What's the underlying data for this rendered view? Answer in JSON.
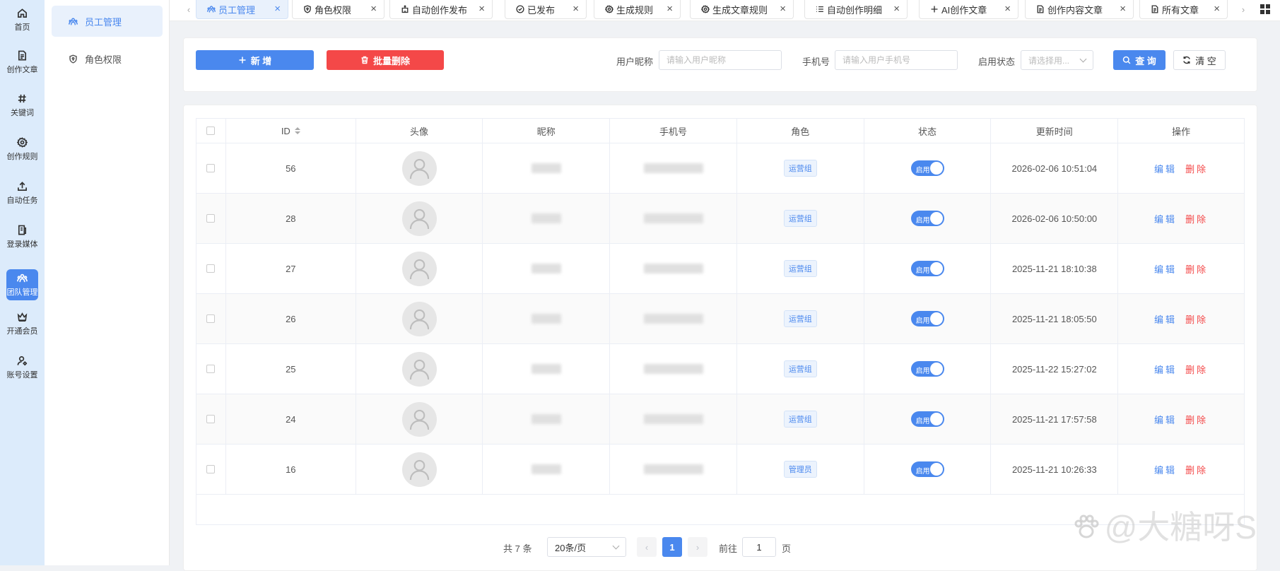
{
  "rail": [
    {
      "label": "首页",
      "icon": "home-icon"
    },
    {
      "label": "创作文章",
      "icon": "document-icon"
    },
    {
      "label": "关键词",
      "icon": "hash-icon"
    },
    {
      "label": "创作规则",
      "icon": "gear-icon"
    },
    {
      "label": "自动任务",
      "icon": "upload-icon"
    },
    {
      "label": "登录媒体",
      "icon": "media-icon"
    },
    {
      "label": "团队管理",
      "icon": "team-icon",
      "active": true
    },
    {
      "label": "开通会员",
      "icon": "crown-icon"
    },
    {
      "label": "账号设置",
      "icon": "user-settings-icon"
    }
  ],
  "submenu": [
    {
      "label": "员工管理",
      "icon": "team-icon",
      "active": true
    },
    {
      "label": "角色权限",
      "icon": "shield-icon"
    }
  ],
  "tabs": [
    {
      "label": "员工管理",
      "icon": "team-icon",
      "active": true
    },
    {
      "label": "角色权限",
      "icon": "shield-icon"
    },
    {
      "label": "自动创作发布",
      "icon": "robot-icon"
    },
    {
      "label": "已发布",
      "icon": "check-circle-icon"
    },
    {
      "label": "生成规则",
      "icon": "gear-icon"
    },
    {
      "label": "生成文章规则",
      "icon": "gear-icon"
    },
    {
      "label": "自动创作明细",
      "icon": "list-icon"
    },
    {
      "label": "AI创作文章",
      "icon": "plus-icon"
    },
    {
      "label": "创作内容文章",
      "icon": "document-icon"
    },
    {
      "label": "所有文章",
      "icon": "document-icon"
    }
  ],
  "toolbar": {
    "add_label": "新 增",
    "batch_delete_label": "批量删除",
    "nickname_label": "用户昵称",
    "nickname_placeholder": "请输入用户昵称",
    "phone_label": "手机号",
    "phone_placeholder": "请输入用户手机号",
    "status_label": "启用状态",
    "status_placeholder": "请选择用...",
    "query_label": "查 询",
    "clear_label": "清 空"
  },
  "table": {
    "columns": [
      "ID",
      "头像",
      "昵称",
      "手机号",
      "角色",
      "状态",
      "更新时间",
      "操作"
    ],
    "rows": [
      {
        "id": "56",
        "role": "运营组",
        "status": "启用",
        "updated": "2026-02-06 10:51:04"
      },
      {
        "id": "28",
        "role": "运营组",
        "status": "启用",
        "updated": "2026-02-06 10:50:00"
      },
      {
        "id": "27",
        "role": "运营组",
        "status": "启用",
        "updated": "2025-11-21 18:10:38"
      },
      {
        "id": "26",
        "role": "运营组",
        "status": "启用",
        "updated": "2025-11-21 18:05:50"
      },
      {
        "id": "25",
        "role": "运营组",
        "status": "启用",
        "updated": "2025-11-22 15:27:02"
      },
      {
        "id": "24",
        "role": "运营组",
        "status": "启用",
        "updated": "2025-11-21 17:57:58"
      },
      {
        "id": "16",
        "role": "管理员",
        "status": "启用",
        "updated": "2025-11-21 10:26:33"
      }
    ],
    "edit_label": "编辑",
    "delete_label": "删除"
  },
  "pagination": {
    "total_text": "共 7 条",
    "page_size": "20条/页",
    "current_page": "1",
    "goto_label": "前往",
    "goto_value": "1",
    "page_suffix": "页"
  },
  "watermark": {
    "text": "@大糖呀S"
  },
  "colors": {
    "accent": "#4a88ee",
    "danger": "#f44848",
    "rail_bg": "#dcebfb"
  }
}
